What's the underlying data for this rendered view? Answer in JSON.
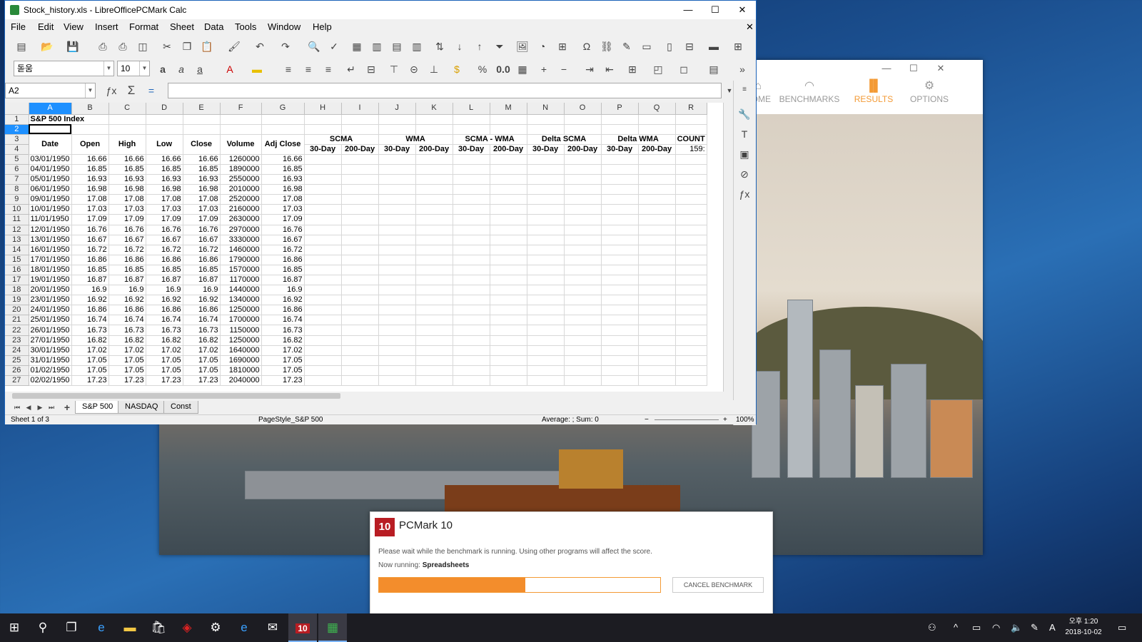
{
  "pcmark_window": {
    "nav": [
      {
        "label": "HOME",
        "icon": "home-icon"
      },
      {
        "label": "BENCHMARKS",
        "icon": "gauge-icon"
      },
      {
        "label": "RESULTS",
        "icon": "bars-icon"
      },
      {
        "label": "OPTIONS",
        "icon": "gear-icon"
      }
    ],
    "accent": "#f39a35"
  },
  "pcmark_dialog": {
    "logo": "10",
    "title": "PCMark 10",
    "message": "Please wait while the benchmark is running. Using other programs will affect the score.",
    "now_running_label": "Now running:",
    "now_running_value": "Spreadsheets",
    "progress_percent": 52,
    "cancel_label": "CANCEL BENCHMARK"
  },
  "calc": {
    "title": "Stock_history.xls - LibreOfficePCMark Calc",
    "menu": [
      "File",
      "Edit",
      "View",
      "Insert",
      "Format",
      "Sheet",
      "Data",
      "Tools",
      "Window",
      "Help"
    ],
    "font_name": "돋움",
    "font_size": "10",
    "cell_ref": "A2",
    "columns": [
      "A",
      "B",
      "C",
      "D",
      "E",
      "F",
      "G",
      "H",
      "I",
      "J",
      "K",
      "L",
      "M",
      "N",
      "O",
      "P",
      "Q",
      "R"
    ],
    "row1_title": "S&P 500 Index",
    "headers": [
      "Date",
      "Open",
      "High",
      "Low",
      "Close",
      "Volume",
      "Adj Close"
    ],
    "groups": [
      "SCMA",
      "WMA",
      "SCMA - WMA",
      "Delta SCMA",
      "Delta WMA",
      "COUNT"
    ],
    "subheaders": [
      "30-Day",
      "200-Day"
    ],
    "count_value": "159:",
    "rows": [
      [
        "03/01/1950",
        "16.66",
        "16.66",
        "16.66",
        "16.66",
        "1260000",
        "16.66"
      ],
      [
        "04/01/1950",
        "16.85",
        "16.85",
        "16.85",
        "16.85",
        "1890000",
        "16.85"
      ],
      [
        "05/01/1950",
        "16.93",
        "16.93",
        "16.93",
        "16.93",
        "2550000",
        "16.93"
      ],
      [
        "06/01/1950",
        "16.98",
        "16.98",
        "16.98",
        "16.98",
        "2010000",
        "16.98"
      ],
      [
        "09/01/1950",
        "17.08",
        "17.08",
        "17.08",
        "17.08",
        "2520000",
        "17.08"
      ],
      [
        "10/01/1950",
        "17.03",
        "17.03",
        "17.03",
        "17.03",
        "2160000",
        "17.03"
      ],
      [
        "11/01/1950",
        "17.09",
        "17.09",
        "17.09",
        "17.09",
        "2630000",
        "17.09"
      ],
      [
        "12/01/1950",
        "16.76",
        "16.76",
        "16.76",
        "16.76",
        "2970000",
        "16.76"
      ],
      [
        "13/01/1950",
        "16.67",
        "16.67",
        "16.67",
        "16.67",
        "3330000",
        "16.67"
      ],
      [
        "16/01/1950",
        "16.72",
        "16.72",
        "16.72",
        "16.72",
        "1460000",
        "16.72"
      ],
      [
        "17/01/1950",
        "16.86",
        "16.86",
        "16.86",
        "16.86",
        "1790000",
        "16.86"
      ],
      [
        "18/01/1950",
        "16.85",
        "16.85",
        "16.85",
        "16.85",
        "1570000",
        "16.85"
      ],
      [
        "19/01/1950",
        "16.87",
        "16.87",
        "16.87",
        "16.87",
        "1170000",
        "16.87"
      ],
      [
        "20/01/1950",
        "16.9",
        "16.9",
        "16.9",
        "16.9",
        "1440000",
        "16.9"
      ],
      [
        "23/01/1950",
        "16.92",
        "16.92",
        "16.92",
        "16.92",
        "1340000",
        "16.92"
      ],
      [
        "24/01/1950",
        "16.86",
        "16.86",
        "16.86",
        "16.86",
        "1250000",
        "16.86"
      ],
      [
        "25/01/1950",
        "16.74",
        "16.74",
        "16.74",
        "16.74",
        "1700000",
        "16.74"
      ],
      [
        "26/01/1950",
        "16.73",
        "16.73",
        "16.73",
        "16.73",
        "1150000",
        "16.73"
      ],
      [
        "27/01/1950",
        "16.82",
        "16.82",
        "16.82",
        "16.82",
        "1250000",
        "16.82"
      ],
      [
        "30/01/1950",
        "17.02",
        "17.02",
        "17.02",
        "17.02",
        "1640000",
        "17.02"
      ],
      [
        "31/01/1950",
        "17.05",
        "17.05",
        "17.05",
        "17.05",
        "1690000",
        "17.05"
      ],
      [
        "01/02/1950",
        "17.05",
        "17.05",
        "17.05",
        "17.05",
        "1810000",
        "17.05"
      ],
      [
        "02/02/1950",
        "17.23",
        "17.23",
        "17.23",
        "17.23",
        "2040000",
        "17.23"
      ]
    ],
    "sheet_tabs": [
      "S&P 500",
      "NASDAQ",
      "Const"
    ],
    "status_sheet": "Sheet 1 of 3",
    "status_style": "PageStyle_S&P 500",
    "status_sum": "Average: ; Sum: 0",
    "zoom": "100%"
  },
  "taskbar": {
    "time": "오후 1:20",
    "date": "2018-10-02",
    "ime": "A"
  }
}
